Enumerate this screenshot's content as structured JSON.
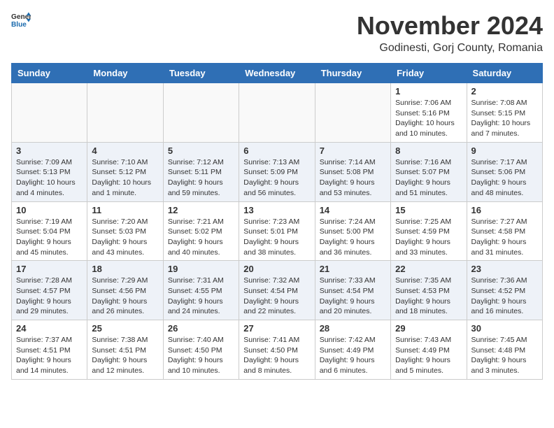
{
  "header": {
    "logo_general": "General",
    "logo_blue": "Blue",
    "month": "November 2024",
    "location": "Godinesti, Gorj County, Romania"
  },
  "weekdays": [
    "Sunday",
    "Monday",
    "Tuesday",
    "Wednesday",
    "Thursday",
    "Friday",
    "Saturday"
  ],
  "weeks": [
    [
      {
        "day": "",
        "info": ""
      },
      {
        "day": "",
        "info": ""
      },
      {
        "day": "",
        "info": ""
      },
      {
        "day": "",
        "info": ""
      },
      {
        "day": "",
        "info": ""
      },
      {
        "day": "1",
        "info": "Sunrise: 7:06 AM\nSunset: 5:16 PM\nDaylight: 10 hours and 10 minutes."
      },
      {
        "day": "2",
        "info": "Sunrise: 7:08 AM\nSunset: 5:15 PM\nDaylight: 10 hours and 7 minutes."
      }
    ],
    [
      {
        "day": "3",
        "info": "Sunrise: 7:09 AM\nSunset: 5:13 PM\nDaylight: 10 hours and 4 minutes."
      },
      {
        "day": "4",
        "info": "Sunrise: 7:10 AM\nSunset: 5:12 PM\nDaylight: 10 hours and 1 minute."
      },
      {
        "day": "5",
        "info": "Sunrise: 7:12 AM\nSunset: 5:11 PM\nDaylight: 9 hours and 59 minutes."
      },
      {
        "day": "6",
        "info": "Sunrise: 7:13 AM\nSunset: 5:09 PM\nDaylight: 9 hours and 56 minutes."
      },
      {
        "day": "7",
        "info": "Sunrise: 7:14 AM\nSunset: 5:08 PM\nDaylight: 9 hours and 53 minutes."
      },
      {
        "day": "8",
        "info": "Sunrise: 7:16 AM\nSunset: 5:07 PM\nDaylight: 9 hours and 51 minutes."
      },
      {
        "day": "9",
        "info": "Sunrise: 7:17 AM\nSunset: 5:06 PM\nDaylight: 9 hours and 48 minutes."
      }
    ],
    [
      {
        "day": "10",
        "info": "Sunrise: 7:19 AM\nSunset: 5:04 PM\nDaylight: 9 hours and 45 minutes."
      },
      {
        "day": "11",
        "info": "Sunrise: 7:20 AM\nSunset: 5:03 PM\nDaylight: 9 hours and 43 minutes."
      },
      {
        "day": "12",
        "info": "Sunrise: 7:21 AM\nSunset: 5:02 PM\nDaylight: 9 hours and 40 minutes."
      },
      {
        "day": "13",
        "info": "Sunrise: 7:23 AM\nSunset: 5:01 PM\nDaylight: 9 hours and 38 minutes."
      },
      {
        "day": "14",
        "info": "Sunrise: 7:24 AM\nSunset: 5:00 PM\nDaylight: 9 hours and 36 minutes."
      },
      {
        "day": "15",
        "info": "Sunrise: 7:25 AM\nSunset: 4:59 PM\nDaylight: 9 hours and 33 minutes."
      },
      {
        "day": "16",
        "info": "Sunrise: 7:27 AM\nSunset: 4:58 PM\nDaylight: 9 hours and 31 minutes."
      }
    ],
    [
      {
        "day": "17",
        "info": "Sunrise: 7:28 AM\nSunset: 4:57 PM\nDaylight: 9 hours and 29 minutes."
      },
      {
        "day": "18",
        "info": "Sunrise: 7:29 AM\nSunset: 4:56 PM\nDaylight: 9 hours and 26 minutes."
      },
      {
        "day": "19",
        "info": "Sunrise: 7:31 AM\nSunset: 4:55 PM\nDaylight: 9 hours and 24 minutes."
      },
      {
        "day": "20",
        "info": "Sunrise: 7:32 AM\nSunset: 4:54 PM\nDaylight: 9 hours and 22 minutes."
      },
      {
        "day": "21",
        "info": "Sunrise: 7:33 AM\nSunset: 4:54 PM\nDaylight: 9 hours and 20 minutes."
      },
      {
        "day": "22",
        "info": "Sunrise: 7:35 AM\nSunset: 4:53 PM\nDaylight: 9 hours and 18 minutes."
      },
      {
        "day": "23",
        "info": "Sunrise: 7:36 AM\nSunset: 4:52 PM\nDaylight: 9 hours and 16 minutes."
      }
    ],
    [
      {
        "day": "24",
        "info": "Sunrise: 7:37 AM\nSunset: 4:51 PM\nDaylight: 9 hours and 14 minutes."
      },
      {
        "day": "25",
        "info": "Sunrise: 7:38 AM\nSunset: 4:51 PM\nDaylight: 9 hours and 12 minutes."
      },
      {
        "day": "26",
        "info": "Sunrise: 7:40 AM\nSunset: 4:50 PM\nDaylight: 9 hours and 10 minutes."
      },
      {
        "day": "27",
        "info": "Sunrise: 7:41 AM\nSunset: 4:50 PM\nDaylight: 9 hours and 8 minutes."
      },
      {
        "day": "28",
        "info": "Sunrise: 7:42 AM\nSunset: 4:49 PM\nDaylight: 9 hours and 6 minutes."
      },
      {
        "day": "29",
        "info": "Sunrise: 7:43 AM\nSunset: 4:49 PM\nDaylight: 9 hours and 5 minutes."
      },
      {
        "day": "30",
        "info": "Sunrise: 7:45 AM\nSunset: 4:48 PM\nDaylight: 9 hours and 3 minutes."
      }
    ]
  ]
}
